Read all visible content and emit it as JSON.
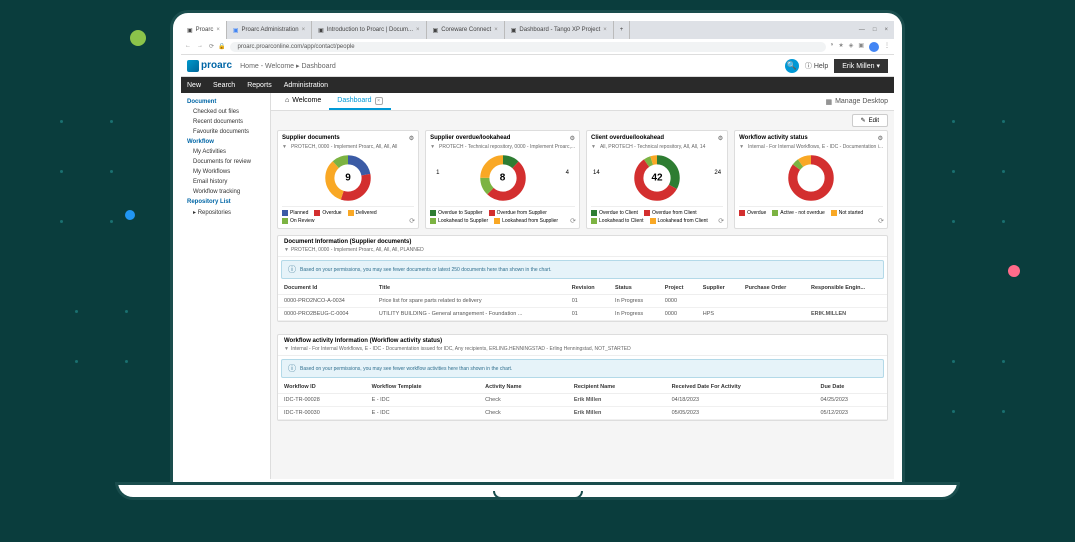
{
  "browser": {
    "tabs": [
      {
        "label": "Proarc",
        "icon": "□"
      },
      {
        "label": "Proarc Administration",
        "icon": "□"
      },
      {
        "label": "Introduction to Proarc | Docum...",
        "icon": "□"
      },
      {
        "label": "Coreware Connect",
        "icon": "□"
      },
      {
        "label": "Dashboard - Tango XP Project",
        "icon": "□"
      }
    ],
    "url": "proarc.proarconline.com/app/contact/people"
  },
  "app": {
    "logo": "proarc",
    "breadcrumb": "Home - Welcome  ▸  Dashboard",
    "help": "Help",
    "user": "Erik Millen"
  },
  "menu": [
    "New",
    "Search",
    "Reports",
    "Administration"
  ],
  "sidebar": {
    "sections": [
      {
        "title": "Document",
        "items": [
          "Checked out files",
          "Recent documents",
          "Favourite documents"
        ]
      },
      {
        "title": "Workflow",
        "items": [
          "My Activities",
          "Documents for review",
          "My Workflows",
          "Email history",
          "Workflow tracking"
        ]
      },
      {
        "title": "Repository List",
        "items": [
          "Repositories"
        ]
      }
    ]
  },
  "tabs": [
    {
      "label": "Welcome",
      "icon": "⌂"
    },
    {
      "label": "Dashboard"
    }
  ],
  "manage_desktop": "Manage Desktop",
  "edit_button": "Edit",
  "cards": [
    {
      "title": "Supplier documents",
      "subtitle": "PROTECH, 0000 - Implement Proarc, All, All, All",
      "center": "9",
      "side_left": "",
      "side_right": "",
      "legend": [
        {
          "color": "#3b5ba5",
          "label": "Planned"
        },
        {
          "color": "#d32f2f",
          "label": "Overdue"
        },
        {
          "color": "#f9a825",
          "label": "Delivered"
        },
        {
          "color": "#7cb342",
          "label": "On Review"
        }
      ]
    },
    {
      "title": "Supplier overdue/lookahead",
      "subtitle": "PROTECH - Technical repository, 0000 - Implement Proarc,...",
      "center": "8",
      "side_left": "1",
      "side_right": "4",
      "legend": [
        {
          "color": "#2e7d32",
          "label": "Overdue to Supplier"
        },
        {
          "color": "#d32f2f",
          "label": "Overdue from Supplier"
        },
        {
          "color": "#7cb342",
          "label": "Lookahead to Supplier"
        },
        {
          "color": "#f9a825",
          "label": "Lookahead from Supplier"
        }
      ]
    },
    {
      "title": "Client overdue/lookahead",
      "subtitle": "All, PROTECH - Technical repository, All, All, 14",
      "center": "42",
      "side_left": "14",
      "side_right": "24",
      "legend": [
        {
          "color": "#2e7d32",
          "label": "Overdue to Client"
        },
        {
          "color": "#d32f2f",
          "label": "Overdue from Client"
        },
        {
          "color": "#7cb342",
          "label": "Lookahead to Client"
        },
        {
          "color": "#f9a825",
          "label": "Lookahead from Client"
        }
      ]
    },
    {
      "title": "Workflow activity status",
      "subtitle": "Internal - For Internal Workflows, E - IDC - Documentation i...",
      "center": "",
      "side_left": "",
      "side_right": "",
      "legend": [
        {
          "color": "#d32f2f",
          "label": "Overdue"
        },
        {
          "color": "#7cb342",
          "label": "Active - not overdue"
        },
        {
          "color": "#f9a825",
          "label": "Not started"
        }
      ]
    }
  ],
  "chart_data": [
    {
      "type": "pie",
      "title": "Supplier documents",
      "total": 9,
      "series": [
        {
          "name": "Planned",
          "value": 2
        },
        {
          "name": "Overdue",
          "value": 3
        },
        {
          "name": "Delivered",
          "value": 3
        },
        {
          "name": "On Review",
          "value": 1
        }
      ]
    },
    {
      "type": "pie",
      "title": "Supplier overdue/lookahead",
      "total": 8,
      "left_callout": 1,
      "right_callout": 4,
      "series": [
        {
          "name": "Overdue to Supplier",
          "value": 1
        },
        {
          "name": "Overdue from Supplier",
          "value": 4
        },
        {
          "name": "Lookahead to Supplier",
          "value": 1
        },
        {
          "name": "Lookahead from Supplier",
          "value": 2
        }
      ]
    },
    {
      "type": "pie",
      "title": "Client overdue/lookahead",
      "total": 42,
      "left_callout": 14,
      "right_callout": 24,
      "series": [
        {
          "name": "Overdue to Client",
          "value": 14
        },
        {
          "name": "Overdue from Client",
          "value": 24
        },
        {
          "name": "Lookahead to Client",
          "value": 2
        },
        {
          "name": "Lookahead from Client",
          "value": 2
        }
      ]
    },
    {
      "type": "pie",
      "title": "Workflow activity status",
      "series": [
        {
          "name": "Overdue",
          "value": 85
        },
        {
          "name": "Active - not overdue",
          "value": 5
        },
        {
          "name": "Not started",
          "value": 10
        }
      ]
    }
  ],
  "panel1": {
    "title": "Document Information (Supplier documents)",
    "subtitle": "PROTECH, 0000 - Implement Proarc, All, All, All, PLANNED",
    "info": "Based on your permissions, you may see fewer documents or latest 250 documents here than shown in the chart.",
    "headers": [
      "Document Id",
      "Title",
      "Revision",
      "Status",
      "Project",
      "Supplier",
      "Purchase Order",
      "Responsible Engin..."
    ],
    "rows": [
      [
        "0000-PRO2NCO-A-0034",
        "Price list for spare parts related to delivery",
        "01",
        "In Progress",
        "0000",
        "",
        "",
        ""
      ],
      [
        "0000-PRO2BEUG-C-0004",
        "UTILITY BUILDING - General arrangement - Foundation ...",
        "01",
        "In Progress",
        "0000",
        "HPS",
        "",
        "ERIK.MILLEN"
      ]
    ]
  },
  "panel2": {
    "title": "Workflow activity Information (Workflow activity status)",
    "subtitle": "Internal - For Internal Workflows, E - IDC - Documentation issued for IDC, Any recipients, ERLING.HENNINGSTAD - Erling Henningstad, NOT_STARTED",
    "info": "Based on your permissions, you may see fewer workflow activities here than shown in the chart.",
    "headers": [
      "Workflow ID",
      "Workflow Template",
      "Activity Name",
      "Recipient Name",
      "Received Date For Activity",
      "Due Date"
    ],
    "rows": [
      [
        "IDC-TR-00028",
        "E - IDC",
        "Check",
        "Erik Millen",
        "04/18/2023",
        "04/25/2023"
      ],
      [
        "IDC-TR-00030",
        "E - IDC",
        "Check",
        "Erik Millen",
        "05/05/2023",
        "05/12/2023"
      ]
    ]
  }
}
